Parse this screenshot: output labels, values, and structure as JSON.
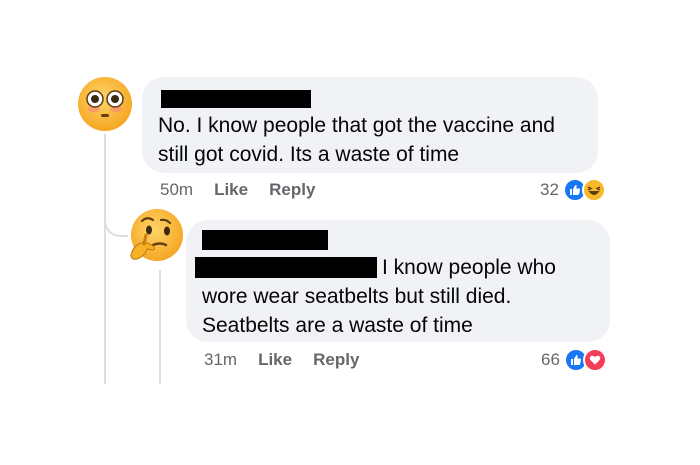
{
  "comment": {
    "text_lines": [
      "No. I know people that got the vaccine and",
      "still got covid. Its a waste of time"
    ],
    "time": "50m",
    "like_label": "Like",
    "reply_label": "Reply",
    "reaction_count": "32",
    "reactions": [
      "like-icon",
      "haha-icon"
    ],
    "avatar_icon": "flushed-face-emoji"
  },
  "reply": {
    "text_lines": [
      "I know people who",
      "wore wear seatbelts but still died.",
      "Seatbelts are a waste of time"
    ],
    "time": "31m",
    "like_label": "Like",
    "reply_label": "Reply",
    "reaction_count": "66",
    "reactions": [
      "like-icon",
      "love-icon"
    ],
    "avatar_icon": "thinking-face-emoji"
  },
  "colors": {
    "bubble": "#f0f2f5",
    "meta_text": "#65676b",
    "like_blue": "#1877f2",
    "love_red": "#f33e58",
    "haha_yellow": "#f7b928"
  }
}
